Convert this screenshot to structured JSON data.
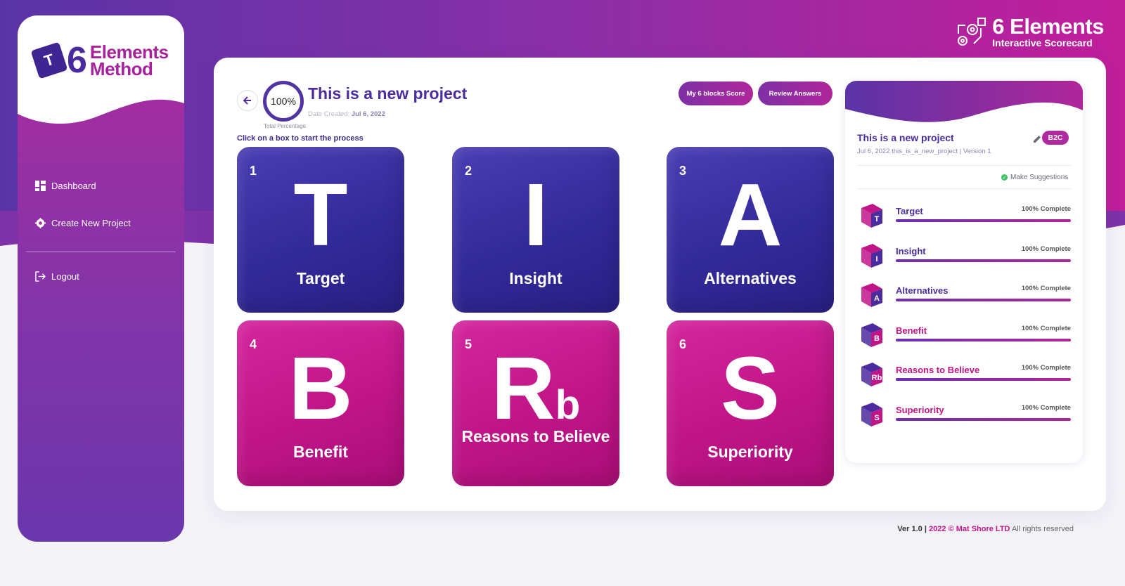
{
  "brand": {
    "logo_letter": "T",
    "logo_six": "6",
    "logo_line1": "Elements",
    "logo_line2": "Method",
    "right_line1": "6 Elements",
    "right_line2": "Interactive Scorecard"
  },
  "sidebar": {
    "items": [
      {
        "label": "Dashboard",
        "icon": "dashboard-icon"
      },
      {
        "label": "Create New Project",
        "icon": "gear-icon"
      },
      {
        "label": "Logout",
        "icon": "logout-icon"
      }
    ]
  },
  "project": {
    "title": "This is a new project",
    "percentage": "100%",
    "percentage_label": "Total Percentage",
    "date_label": "Date Created:",
    "date_value": "Jul 6, 2022",
    "instruction": "Click on a box to start the process"
  },
  "actions": {
    "score_label": "My 6 blocks Score",
    "review_label": "Review Answers"
  },
  "tiles": [
    {
      "num": "1",
      "symbol": "T",
      "name": "Target",
      "color": "blue"
    },
    {
      "num": "2",
      "symbol": "I",
      "name": "Insight",
      "color": "blue"
    },
    {
      "num": "3",
      "symbol": "A",
      "name": "Alternatives",
      "color": "blue"
    },
    {
      "num": "4",
      "symbol": "B",
      "name": "Benefit",
      "color": "pink"
    },
    {
      "num": "5",
      "symbol": "R",
      "symbol_sub": "b",
      "name": "Reasons to Believe",
      "color": "pink"
    },
    {
      "num": "6",
      "symbol": "S",
      "name": "Superiority",
      "color": "pink"
    }
  ],
  "panel": {
    "title": "This is a new project",
    "badge": "B2C",
    "meta_date": "Jul 6, 2022",
    "meta_slug": "this_is_a_new_project",
    "meta_sep": "|",
    "meta_version": "Version 1",
    "suggest_label": "Make Suggestions",
    "rows": [
      {
        "label": "Target",
        "letter": "T",
        "status": "100% Complete",
        "progress": 1.0,
        "color": "blue"
      },
      {
        "label": "Insight",
        "letter": "I",
        "status": "100% Complete",
        "progress": 1.0,
        "color": "blue"
      },
      {
        "label": "Alternatives",
        "letter": "A",
        "status": "100% Complete",
        "progress": 1.0,
        "color": "blue"
      },
      {
        "label": "Benefit",
        "letter": "B",
        "status": "100% Complete",
        "progress": 1.0,
        "color": "pink"
      },
      {
        "label": "Reasons to Believe",
        "letter": "Rb",
        "status": "100% Complete",
        "progress": 1.0,
        "color": "pink"
      },
      {
        "label": "Superiority",
        "letter": "S",
        "status": "100% Complete",
        "progress": 1.0,
        "color": "pink"
      }
    ]
  },
  "footer": {
    "version": "Ver 1.0",
    "sep": "|",
    "copyright": "2022 © Mat Shore LTD",
    "rights": "All rights reserved"
  },
  "colors": {
    "primary_purple": "#4b2b9e",
    "primary_pink": "#c01588",
    "success": "#3fc46a"
  }
}
